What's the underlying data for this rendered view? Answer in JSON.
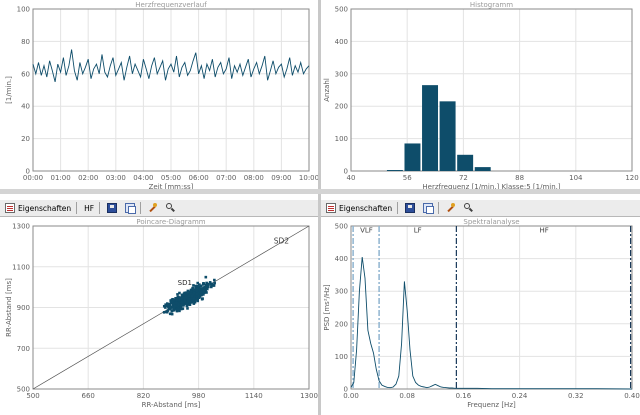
{
  "toolbar": {
    "properties_label": "Eigenschaften",
    "hf_label": "HF",
    "icons": [
      "properties-icon",
      "save-icon",
      "copy-icon",
      "zoom-in-icon",
      "zoom-out-icon"
    ]
  },
  "colors": {
    "series": "#0e4d6a",
    "grid": "#e3e3e3",
    "frame": "#8a8a8a",
    "title": "#9a9a9a",
    "vlf_line": "#8fb4d0",
    "hf_line": "#1a3a5a"
  },
  "chart_data": [
    {
      "id": "hr_trend",
      "type": "line",
      "title": "Herzfrequenzverlauf",
      "xlabel": "Zeit [mm:ss]",
      "ylabel": "[1/min.]",
      "xlim": [
        0,
        600
      ],
      "ylim": [
        0,
        100
      ],
      "x_ticks": [
        "00:00",
        "01:00",
        "02:00",
        "03:00",
        "04:00",
        "05:00",
        "06:00",
        "07:00",
        "08:00",
        "09:00",
        "10:00"
      ],
      "y_ticks": [
        "0",
        "20",
        "40",
        "60",
        "80",
        "100"
      ],
      "series": [
        {
          "x": [
            0,
            6,
            12,
            18,
            24,
            30,
            36,
            42,
            48,
            54,
            60,
            66,
            72,
            78,
            84,
            90,
            96,
            102,
            108,
            114,
            120,
            126,
            132,
            138,
            144,
            150,
            156,
            162,
            168,
            174,
            180,
            186,
            192,
            198,
            204,
            210,
            216,
            222,
            228,
            234,
            240,
            246,
            252,
            258,
            264,
            270,
            276,
            282,
            288,
            294,
            300,
            306,
            312,
            318,
            324,
            330,
            336,
            342,
            348,
            354,
            360,
            366,
            372,
            378,
            384,
            390,
            396,
            402,
            408,
            414,
            420,
            426,
            432,
            438,
            444,
            450,
            456,
            462,
            468,
            474,
            480,
            486,
            492,
            498,
            504,
            510,
            516,
            522,
            528,
            534,
            540,
            546,
            552,
            558,
            564,
            570,
            576,
            582,
            588,
            594,
            600
          ],
          "values": [
            66,
            60,
            67,
            59,
            65,
            58,
            68,
            62,
            55,
            66,
            61,
            70,
            59,
            65,
            75,
            62,
            56,
            67,
            60,
            64,
            69,
            57,
            63,
            66,
            60,
            72,
            61,
            58,
            65,
            70,
            59,
            63,
            67,
            56,
            64,
            71,
            60,
            66,
            62,
            58,
            69,
            63,
            57,
            65,
            70,
            60,
            64,
            68,
            56,
            63,
            66,
            61,
            71,
            58,
            64,
            67,
            59,
            62,
            68,
            73,
            60,
            65,
            57,
            66,
            62,
            69,
            58,
            64,
            67,
            60,
            63,
            70,
            57,
            65,
            61,
            66,
            59,
            64,
            69,
            58,
            63,
            67,
            60,
            65,
            71,
            56,
            62,
            68,
            60,
            64,
            66,
            58,
            63,
            70,
            59,
            65,
            61,
            67,
            60,
            63,
            65
          ]
        }
      ]
    },
    {
      "id": "histogram",
      "type": "bar",
      "title": "Histogramm",
      "xlabel": "Herzfrequenz [1/min.] Klasse:5 [1/min.]",
      "ylabel": "Anzahl",
      "xlim": [
        40,
        120
      ],
      "ylim": [
        0,
        500
      ],
      "x_ticks": [
        "40",
        "56",
        "72",
        "88",
        "104",
        "120"
      ],
      "y_ticks": [
        "0",
        "100",
        "200",
        "300",
        "400",
        "500"
      ],
      "bins": [
        {
          "start": 50,
          "end": 55,
          "value": 3
        },
        {
          "start": 55,
          "end": 60,
          "value": 85
        },
        {
          "start": 60,
          "end": 65,
          "value": 265
        },
        {
          "start": 65,
          "end": 70,
          "value": 215
        },
        {
          "start": 70,
          "end": 75,
          "value": 50
        },
        {
          "start": 75,
          "end": 80,
          "value": 12
        }
      ]
    },
    {
      "id": "poincare",
      "type": "scatter",
      "title": "Poincare-Diagramm",
      "xlabel": "RR-Abstand [ms]",
      "ylabel": "RR-Abstand [ms]",
      "xlim": [
        500,
        1300
      ],
      "ylim": [
        500,
        1300
      ],
      "x_ticks": [
        "500",
        "660",
        "820",
        "980",
        "1140",
        "1300"
      ],
      "y_ticks": [
        "500",
        "700",
        "900",
        "1100",
        "1300"
      ],
      "annotations": [
        "SD2",
        "SD1"
      ],
      "cloud": {
        "center_x": 950,
        "center_y": 950,
        "sd_along": 70,
        "sd_across": 18,
        "n": 520
      }
    },
    {
      "id": "spectrum",
      "type": "line",
      "title": "Spektralanalyse",
      "xlabel": "Frequenz [Hz]",
      "ylabel": "PSD [ms²/Hz]",
      "xlim": [
        0,
        0.4
      ],
      "ylim": [
        0,
        500
      ],
      "x_ticks": [
        "0.00",
        "0.08",
        "0.16",
        "0.24",
        "0.32",
        "0.40"
      ],
      "y_ticks": [
        "0",
        "100",
        "200",
        "300",
        "400",
        "500"
      ],
      "bands": [
        {
          "label": "VLF",
          "start": 0.003,
          "end": 0.04
        },
        {
          "label": "LF",
          "start": 0.04,
          "end": 0.15
        },
        {
          "label": "HF",
          "start": 0.15,
          "end": 0.4
        }
      ],
      "series": [
        {
          "x": [
            0.0,
            0.004,
            0.008,
            0.012,
            0.016,
            0.02,
            0.024,
            0.028,
            0.032,
            0.036,
            0.04,
            0.044,
            0.048,
            0.052,
            0.056,
            0.06,
            0.064,
            0.068,
            0.072,
            0.076,
            0.08,
            0.084,
            0.088,
            0.092,
            0.096,
            0.1,
            0.104,
            0.108,
            0.112,
            0.116,
            0.12,
            0.124,
            0.128,
            0.132,
            0.136,
            0.14,
            0.144,
            0.148,
            0.152,
            0.16,
            0.18,
            0.2,
            0.25,
            0.3,
            0.35,
            0.4
          ],
          "values": [
            5,
            20,
            120,
            300,
            405,
            340,
            180,
            140,
            110,
            60,
            25,
            12,
            8,
            5,
            4,
            6,
            15,
            40,
            140,
            330,
            240,
            120,
            40,
            20,
            12,
            8,
            6,
            4,
            6,
            10,
            14,
            10,
            6,
            5,
            4,
            3,
            3,
            2,
            2,
            2,
            2,
            1,
            1,
            1,
            1,
            0
          ]
        }
      ]
    }
  ]
}
